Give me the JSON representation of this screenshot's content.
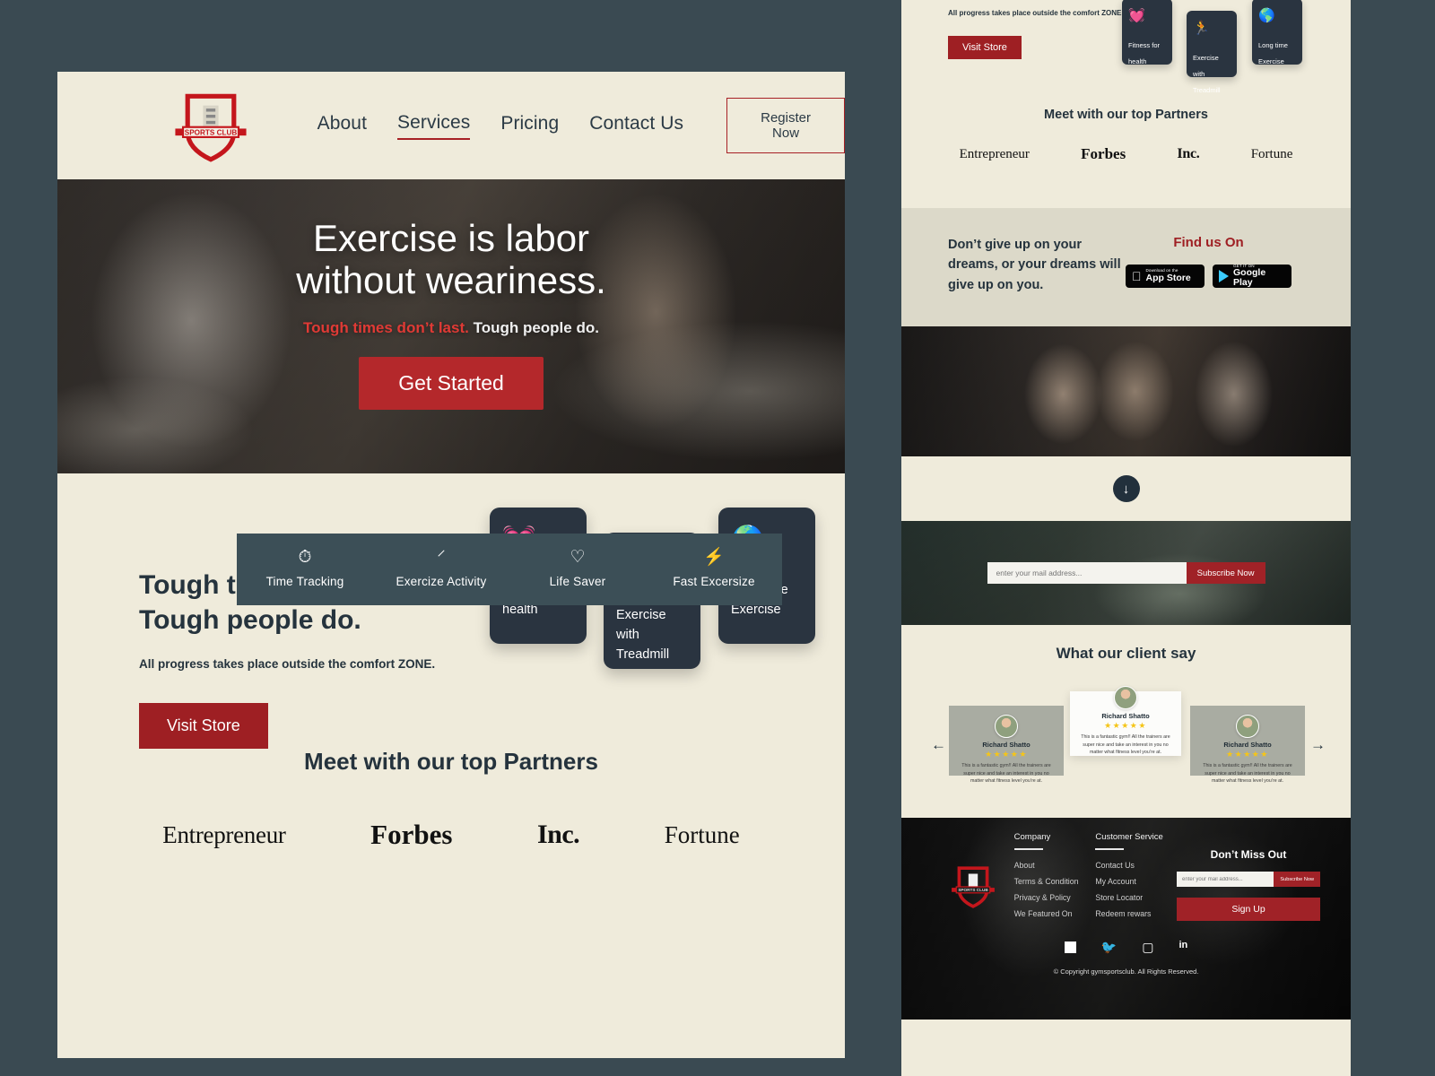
{
  "brand": {
    "logo_text": "SPORTS CLUB",
    "accent_red": "#a72025",
    "dark_navy": "#25333d",
    "cream": "#efebdb"
  },
  "nav": {
    "items": [
      {
        "label": "About",
        "active": false
      },
      {
        "label": "Services",
        "active": true
      },
      {
        "label": "Pricing",
        "active": false
      },
      {
        "label": "Contact Us",
        "active": false
      }
    ],
    "register_label": "Register Now"
  },
  "hero": {
    "title_line1": "Exercise is labor",
    "title_line2": "without weariness.",
    "sub_red": "Tough times don’t last.",
    "sub_white": " Tough people do.",
    "cta": "Get Started"
  },
  "features": [
    {
      "icon": "alarm-clock-icon",
      "glyph": "⏱",
      "label": "Time Tracking"
    },
    {
      "icon": "activity-pulse-icon",
      "glyph": "⸍",
      "label": "Exercize Activity"
    },
    {
      "icon": "heart-icon",
      "glyph": "♡",
      "label": "Life Saver"
    },
    {
      "icon": "fast-exercise-icon",
      "glyph": "⚡",
      "label": "Fast Excersize"
    }
  ],
  "tough": {
    "heading_line1": "Tough times don’t last.",
    "heading_line2": "Tough people do.",
    "paragraph": "All progress takes place outside the comfort ZONE.",
    "cta": "Visit Store",
    "cards": [
      {
        "icon": "heart-dumbbell-icon",
        "glyph": "💓",
        "title": "Fitness for health"
      },
      {
        "icon": "treadmill-runner-icon",
        "glyph": "🏃",
        "title": "Exercise with Treadmill"
      },
      {
        "icon": "globe-athlete-icon",
        "glyph": "🌎",
        "title": "Long time Exercise"
      }
    ]
  },
  "partners": {
    "heading": "Meet with our top Partners",
    "logos": [
      "Entrepreneur",
      "Forbes",
      "Inc.",
      "Fortune"
    ]
  },
  "dreams": {
    "quote": "Don’t give up on your dreams, or your dreams will give up on you.",
    "find_us_on": "Find us On",
    "badges": [
      {
        "icon": "apple-icon",
        "glyph": "",
        "small": "Download on the",
        "big": "App Store"
      },
      {
        "icon": "google-play-icon",
        "glyph": "",
        "small": "GET IT ON",
        "big": "Google Play"
      }
    ]
  },
  "scroll": {
    "icon": "arrow-down-icon",
    "glyph": "↓"
  },
  "newsletter": {
    "placeholder": "enter your mail address...",
    "button": "Subscribe Now"
  },
  "testimonials": {
    "heading": "What our client say",
    "prev_icon": "arrow-left-icon",
    "prev_glyph": "←",
    "next_icon": "arrow-right-icon",
    "next_glyph": "→",
    "items": [
      {
        "name": "Richard Shatto",
        "stars": "★★★★★",
        "quote": "This is a fantastic gym!! All the trainers are super nice and take an interest in you no matter what fitness level you’re at."
      },
      {
        "name": "Richard Shatto",
        "stars": "★★★★★",
        "quote": "This is a fantastic gym!! All the trainers are super nice and take an interest in you no matter what fitness level you’re at."
      },
      {
        "name": "Richard Shatto",
        "stars": "★★★★★",
        "quote": "This is a fantastic gym!! All the trainers are super nice and take an interest in you no matter what fitness level you’re at."
      }
    ]
  },
  "footer": {
    "col1_heading": "Company",
    "col1_links": [
      "About",
      "Terms & Condition",
      "Privacy & Policy",
      "We Featured On"
    ],
    "col2_heading": "Customer Service",
    "col2_links": [
      "Contact Us",
      "My Account",
      "Store Locator",
      "Redeem rewars"
    ],
    "dont_miss_out": "Don’t Miss Out",
    "mail_placeholder": "enter your mail address...",
    "subscribe_label": "Subscribe Now",
    "signup_label": "Sign Up",
    "social": [
      {
        "icon": "facebook-icon",
        "glyph": "f"
      },
      {
        "icon": "twitter-icon",
        "glyph": "🐦"
      },
      {
        "icon": "instagram-icon",
        "glyph": "▢"
      },
      {
        "icon": "linkedin-icon",
        "glyph": "in"
      }
    ],
    "copyright": "© Copyright gymsportsclub. All Rights Reserved."
  }
}
